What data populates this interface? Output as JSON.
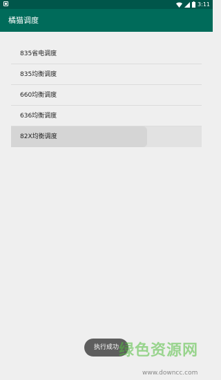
{
  "status": {
    "time": "3:11"
  },
  "app": {
    "title": "橘猫调度"
  },
  "list": {
    "items": [
      {
        "label": "835省电调度"
      },
      {
        "label": "835均衡调度"
      },
      {
        "label": "660均衡调度"
      },
      {
        "label": "636均衡调度"
      },
      {
        "label": "82X均衡调度"
      }
    ]
  },
  "toast": {
    "text": "执行成功"
  },
  "watermark": {
    "text": "绿色资源网",
    "url": "www.downcc.com"
  },
  "colors": {
    "app_bar": "#006b5a",
    "status_bar": "#00564a",
    "background": "#efefef"
  }
}
